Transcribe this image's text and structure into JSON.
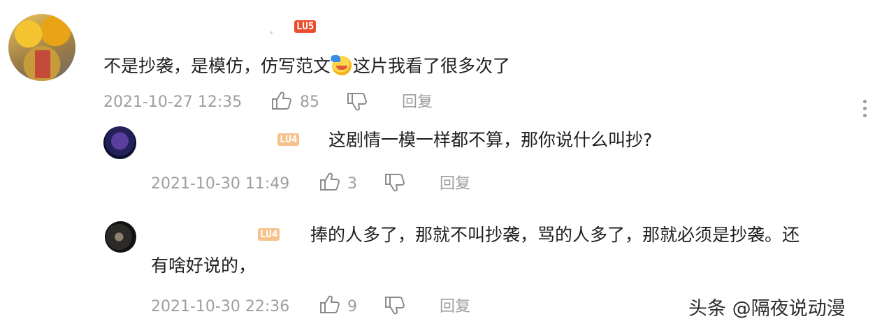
{
  "comments": [
    {
      "level_badge": "LU5",
      "text_before_emoji": "不是抄袭，是模仿，仿写范文",
      "emoji": "laughing-emoji",
      "text_after_emoji": "这片我看了很多次了",
      "date": "2021-10-27 12:35",
      "likes": "85",
      "reply_label": "回复"
    }
  ],
  "replies": [
    {
      "level_badge": "LU4",
      "text": "这剧情一模一样都不算，那你说什么叫抄?",
      "date": "2021-10-30 11:49",
      "likes": "3",
      "reply_label": "回复"
    },
    {
      "level_badge": "LU4",
      "text_line1": "捧的人多了，那就不叫抄袭，骂的人多了，那就必须是抄袭。还",
      "text_line2": "有啥好说的，",
      "date": "2021-10-30 22:36",
      "likes": "9",
      "reply_label": "回复"
    }
  ],
  "watermark": "头条 @隔夜说动漫",
  "colors": {
    "badge_lu5": "#ee4b2e",
    "badge_lu4": "#f6c18a",
    "meta_text": "#9e9e9e",
    "icon": "#8a8a8a"
  },
  "icons": [
    "thumbs-up-icon",
    "thumbs-down-icon",
    "more-vertical-icon"
  ]
}
